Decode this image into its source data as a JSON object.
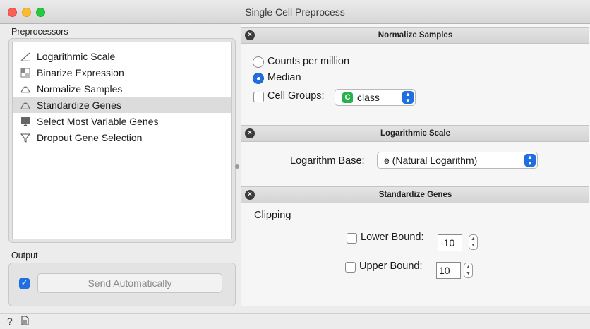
{
  "window": {
    "title": "Single Cell Preprocess"
  },
  "preprocessors": {
    "label": "Preprocessors",
    "items": [
      {
        "label": "Logarithmic Scale",
        "icon": "log-scale-icon"
      },
      {
        "label": "Binarize Expression",
        "icon": "binarize-icon"
      },
      {
        "label": "Normalize Samples",
        "icon": "normalize-icon"
      },
      {
        "label": "Standardize Genes",
        "icon": "standardize-icon",
        "selected": true
      },
      {
        "label": "Select Most Variable Genes",
        "icon": "variable-genes-icon"
      },
      {
        "label": "Dropout Gene Selection",
        "icon": "filter-icon"
      }
    ]
  },
  "output": {
    "label": "Output",
    "send_automatically_checked": true,
    "send_label": "Send Automatically"
  },
  "normalize_samples": {
    "title": "Normalize Samples",
    "options": [
      {
        "label": "Counts per million",
        "checked": false
      },
      {
        "label": "Median",
        "checked": true
      }
    ],
    "cell_groups_label": "Cell Groups:",
    "cell_groups_checked": false,
    "cell_groups_badge": "C",
    "cell_groups_value": "class"
  },
  "logarithmic_scale": {
    "title": "Logarithmic Scale",
    "base_label": "Logarithm Base:",
    "base_value": "e (Natural Logarithm)"
  },
  "standardize_genes": {
    "title": "Standardize Genes",
    "clipping_label": "Clipping",
    "lower_label": "Lower Bound:",
    "lower_checked": false,
    "lower_value": "-10",
    "upper_label": "Upper Bound:",
    "upper_checked": false,
    "upper_value": "10"
  },
  "colors": {
    "accent": "#1f6fe0",
    "badge_green": "#27b14a"
  },
  "footer": {
    "icons": [
      "help-icon",
      "report-icon"
    ]
  }
}
